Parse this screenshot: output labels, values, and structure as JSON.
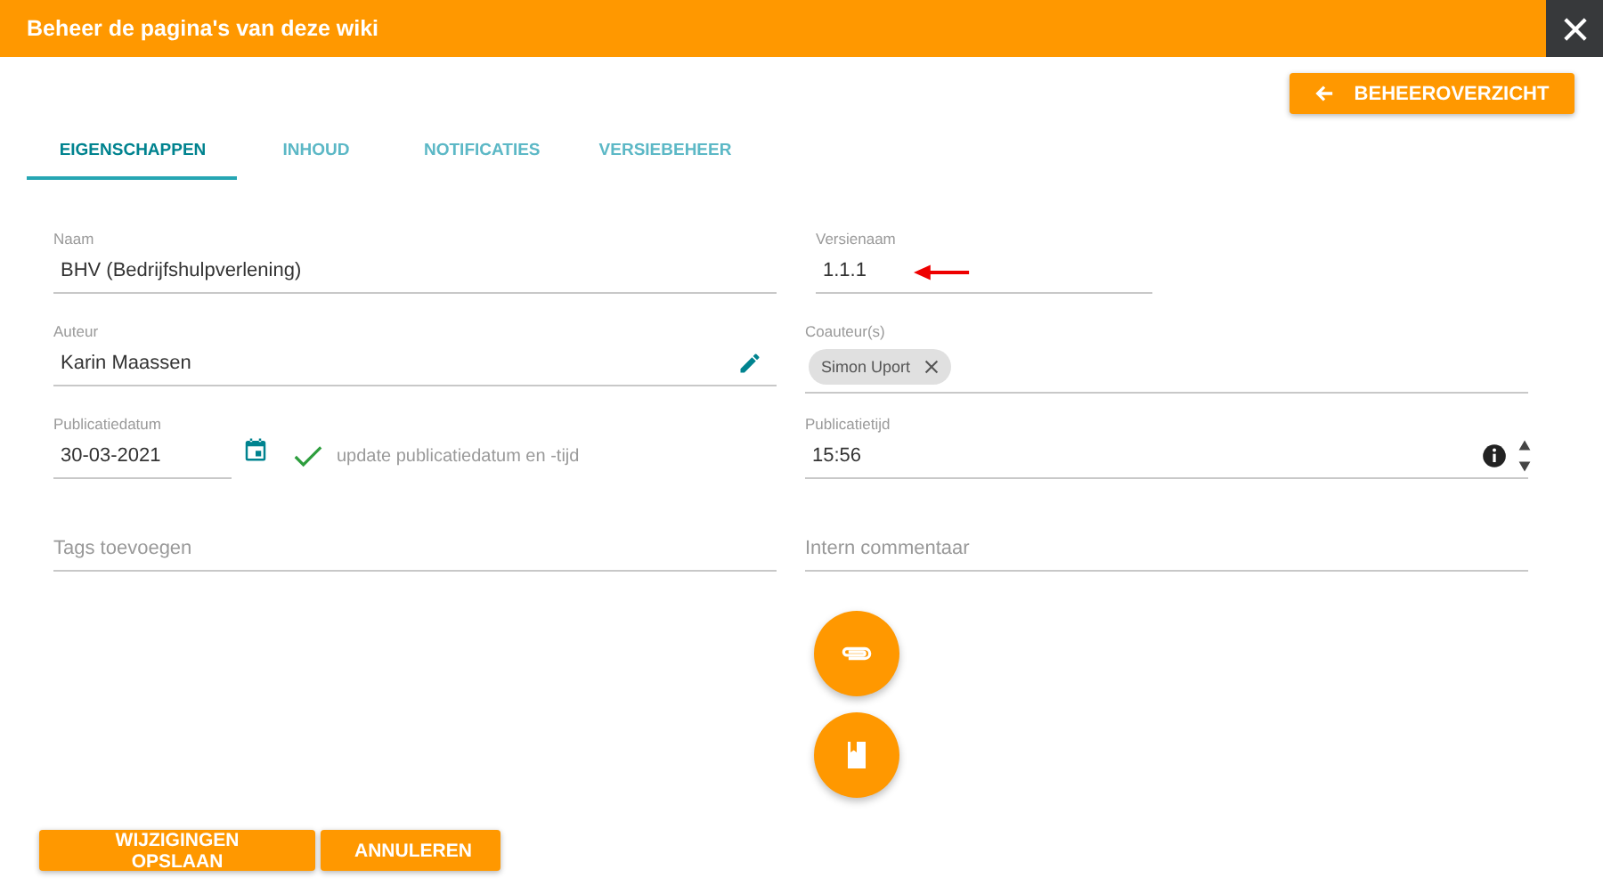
{
  "header": {
    "title": "Beheer de pagina's van deze wiki"
  },
  "back_button": {
    "label": "BEHEEROVERZICHT"
  },
  "tabs": [
    {
      "label": "EIGENSCHAPPEN",
      "selected": true
    },
    {
      "label": "INHOUD",
      "selected": false
    },
    {
      "label": "NOTIFICATIES",
      "selected": false
    },
    {
      "label": "VERSIEBEHEER",
      "selected": false
    }
  ],
  "fields_left": [
    {
      "kind": "text",
      "label": "Naam",
      "value": "BHV (Bedrijfshulpverlening)"
    },
    {
      "kind": "editable",
      "label": "Auteur",
      "value": "Karin Maassen"
    },
    {
      "kind": "date",
      "label": "Publicatiedatum",
      "value": "30-03-2021",
      "option": "update publicatiedatum en -tijd",
      "checked": true
    },
    {
      "kind": "placeholder",
      "placeholder": "Tags toevoegen"
    }
  ],
  "fields_right": [
    {
      "kind": "short",
      "label": "Versienaam",
      "value": "1.1.1"
    },
    {
      "kind": "chips",
      "label": "Coauteur(s)",
      "chips": [
        "Simon Uport"
      ]
    },
    {
      "kind": "time",
      "label": "Publicatietijd",
      "value": "15:56"
    },
    {
      "kind": "placeholder",
      "placeholder": "Intern commentaar"
    }
  ],
  "actions": [
    "WIJZIGINGEN OPSLAAN",
    "ANNULEREN"
  ]
}
